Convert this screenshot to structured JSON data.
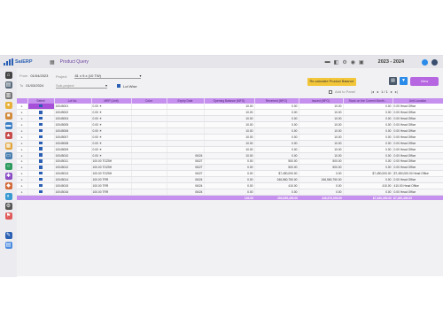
{
  "app": {
    "brand": "SaiERP",
    "page_title": "Product Query",
    "fiscal_year": "2023 - 2024"
  },
  "filters": {
    "from_label": "From",
    "from_date": "01/04/2023",
    "to_label": "To",
    "to_date": "01/03/2024",
    "project_label": "Project",
    "project_value": "81 x 9.x (10 TW)",
    "sub_label": "Sub-project",
    "lot_wise_label": "Lot Wise",
    "lot_wise_checked": true,
    "add_panel_label": "Add to Panel",
    "add_panel_checked": false,
    "pagination": "1 / 1",
    "recalc_button": "Re-calculate Product Balance",
    "view_button": "View"
  },
  "colors": {
    "accent": "#b566e0",
    "header_bg": "#c690ee",
    "selected_cell": "#a64fd8",
    "yellow_btn": "#f3c63a",
    "brand_blue": "#2b5fb3"
  },
  "table": {
    "columns": [
      "",
      "Select",
      "Lot No.",
      "MRP (Unit)",
      "Color",
      "Expiry Date",
      "Opening Balance (MFG)",
      "Received (MFG)",
      "Issued (MFG)",
      "Stock on the Current Month...",
      "Unit Location"
    ],
    "rows": [
      {
        "lot": "10045001",
        "mrp": "0.00 ☀",
        "color": "",
        "exp": "",
        "open": "10.00",
        "recv": "0.00",
        "issued": "10.00",
        "stock": "0.00",
        "loc": "0.00 Head Office",
        "selected": true
      },
      {
        "lot": "10045002",
        "mrp": "0.00 ☀",
        "color": "",
        "exp": "",
        "open": "10.00",
        "recv": "0.00",
        "issued": "10.00",
        "stock": "0.00",
        "loc": "0.00 Head Office",
        "selected": false
      },
      {
        "lot": "10045004",
        "mrp": "0.00 ☀",
        "color": "",
        "exp": "",
        "open": "10.00",
        "recv": "0.00",
        "issued": "10.00",
        "stock": "0.00",
        "loc": "0.00 Head Office",
        "selected": false
      },
      {
        "lot": "10045005",
        "mrp": "0.00 ☀",
        "color": "",
        "exp": "",
        "open": "10.00",
        "recv": "0.00",
        "issued": "10.00",
        "stock": "0.00",
        "loc": "0.00 Head Office",
        "selected": false
      },
      {
        "lot": "10045006",
        "mrp": "0.00 ☀",
        "color": "",
        "exp": "",
        "open": "10.00",
        "recv": "0.00",
        "issued": "10.00",
        "stock": "0.00",
        "loc": "0.00 Head Office",
        "selected": false
      },
      {
        "lot": "10045007",
        "mrp": "0.00 ☀",
        "color": "",
        "exp": "",
        "open": "10.00",
        "recv": "0.00",
        "issued": "10.00",
        "stock": "0.00",
        "loc": "0.00 Head Office",
        "selected": false
      },
      {
        "lot": "10045008",
        "mrp": "0.00 ☀",
        "color": "",
        "exp": "",
        "open": "10.00",
        "recv": "0.00",
        "issued": "10.00",
        "stock": "0.00",
        "loc": "0.00 Head Office",
        "selected": false
      },
      {
        "lot": "10045009",
        "mrp": "0.00 ☀",
        "color": "",
        "exp": "",
        "open": "10.00",
        "recv": "0.00",
        "issued": "10.00",
        "stock": "0.00",
        "loc": "0.00 Head Office",
        "selected": false
      },
      {
        "lot": "10045010",
        "mrp": "0.00 ☀",
        "color": "",
        "exp": "06/24",
        "open": "10.00",
        "recv": "0.00",
        "issued": "10.00",
        "stock": "0.00",
        "loc": "0.00 Head Office",
        "selected": false
      },
      {
        "lot": "10045011",
        "mrp": "100.00 TOZ5H",
        "color": "",
        "exp": "06/27",
        "open": "0.00",
        "recv": "500.00",
        "issued": "500.00",
        "stock": "0.00",
        "loc": "0.00 Head Office",
        "selected": false
      },
      {
        "lot": "10045012",
        "mrp": "100.00 TOZ5H",
        "color": "",
        "exp": "06/27",
        "open": "0.00",
        "recv": "500.00",
        "issued": "500.00",
        "stock": "0.00",
        "loc": "0.00 Head Office",
        "selected": false
      },
      {
        "lot": "10045013",
        "mrp": "100.00 TOZ5H",
        "color": "",
        "exp": "06/27",
        "open": "0.00",
        "recv": "$7,450,000.00",
        "issued": "0.00",
        "stock": "$7,450,000.00",
        "loc": "$7,450,000.00 Head Office",
        "selected": false
      },
      {
        "lot": "10045014",
        "mrp": "100.00 TRR",
        "color": "",
        "exp": "06/24",
        "open": "0.00",
        "recv": "246,560,750.00",
        "issued": "246,560,750.00",
        "stock": "0.00",
        "loc": "0.00 Head Office",
        "selected": false
      },
      {
        "lot": "10045015",
        "mrp": "100.00 TRR",
        "color": "",
        "exp": "06/24",
        "open": "0.00",
        "recv": "410.00",
        "issued": "0.00",
        "stock": "410.00",
        "loc": "410.00 Head Office",
        "selected": false
      },
      {
        "lot": "10045016",
        "mrp": "100.00 TRR",
        "color": "",
        "exp": "06/24",
        "open": "0.00",
        "recv": "0.00",
        "issued": "0.00",
        "stock": "0.00",
        "loc": "0.00 Head Office",
        "selected": false
      }
    ],
    "totals": {
      "open": "130.00",
      "recv": "255,055,490.00",
      "issued": "246,570,000.00",
      "stock": "$7,450,490.00",
      "loc": "$7,450,490.00"
    }
  },
  "sidebar": {
    "icons": [
      "home-icon",
      "building-icon",
      "bank-icon",
      "coins-icon",
      "box-icon",
      "folder-icon",
      "chart-icon",
      "calendar-icon",
      "truck-icon",
      "search-icon",
      "gear-icon",
      "report-icon",
      "user-icon",
      "settings-icon",
      "flag-icon",
      "tools-icon",
      "doc-icon"
    ]
  }
}
